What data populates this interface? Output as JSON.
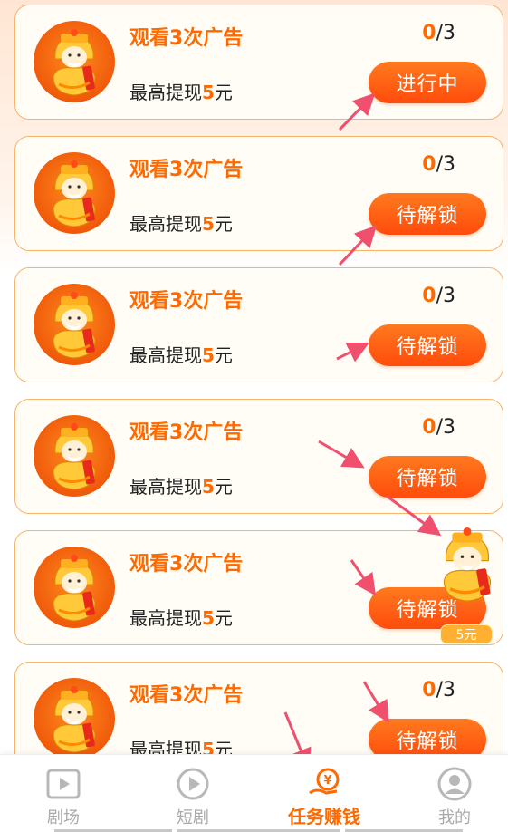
{
  "tasks": [
    {
      "title": "观看3次广告",
      "reward_prefix": "最高提现",
      "reward_amount": "5",
      "reward_suffix": "元",
      "progress_done": "0",
      "progress_total": "/3",
      "button": "进行中"
    },
    {
      "title": "观看3次广告",
      "reward_prefix": "最高提现",
      "reward_amount": "5",
      "reward_suffix": "元",
      "progress_done": "0",
      "progress_total": "/3",
      "button": "待解锁"
    },
    {
      "title": "观看3次广告",
      "reward_prefix": "最高提现",
      "reward_amount": "5",
      "reward_suffix": "元",
      "progress_done": "0",
      "progress_total": "/3",
      "button": "待解锁"
    },
    {
      "title": "观看3次广告",
      "reward_prefix": "最高提现",
      "reward_amount": "5",
      "reward_suffix": "元",
      "progress_done": "0",
      "progress_total": "/3",
      "button": "待解锁"
    },
    {
      "title": "观看3次广告",
      "reward_prefix": "最高提现",
      "reward_amount": "5",
      "reward_suffix": "元",
      "progress_done": "",
      "progress_total": "",
      "button": "待解锁"
    },
    {
      "title": "观看3次广告",
      "reward_prefix": "最高提现",
      "reward_amount": "5",
      "reward_suffix": "元",
      "progress_done": "0",
      "progress_total": "/3",
      "button": "待解锁"
    }
  ],
  "float_widget": {
    "badge": "5元",
    "icon": "money-god-icon"
  },
  "tabs": [
    {
      "label": "剧场",
      "icon": "theater-icon",
      "active": false
    },
    {
      "label": "短剧",
      "icon": "play-icon",
      "active": false
    },
    {
      "label": "任务赚钱",
      "icon": "money-hand-icon",
      "active": true
    },
    {
      "label": "我的",
      "icon": "profile-icon",
      "active": false
    }
  ],
  "colors": {
    "accent": "#ff6a00",
    "button": "#ff5a10",
    "card_border": "#f7b36a",
    "annotation_arrow": "#f0506e"
  }
}
